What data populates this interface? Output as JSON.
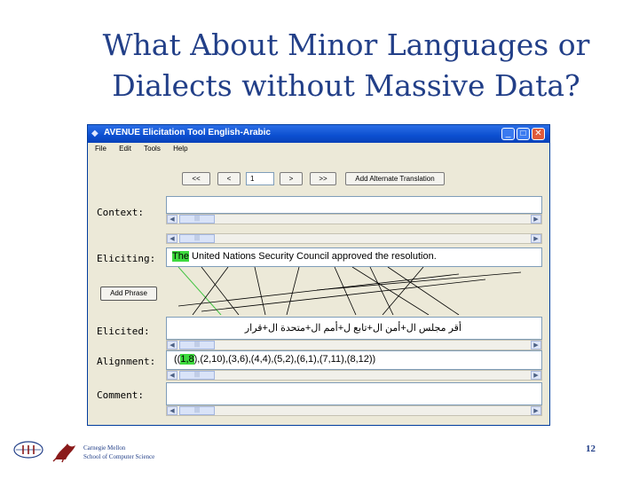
{
  "slide": {
    "title_line1": "What About Minor Languages or",
    "title_line2": "Dialects without Massive Data?",
    "footer_line1": "Carnegie Mellon",
    "footer_line2": "School of Computer Science",
    "page_number": "12"
  },
  "window": {
    "title": "AVENUE Elicitation Tool English-Arabic",
    "menu": [
      "File",
      "Edit",
      "Tools",
      "Help"
    ],
    "controls": [
      "_",
      "□",
      "✕"
    ]
  },
  "toolbar": {
    "first": "<<",
    "prev": "<",
    "index": "1",
    "next": ">",
    "last": ">>",
    "add_alternate": "Add Alternate Translation"
  },
  "labels": {
    "context": "Context:",
    "eliciting": "Eliciting:",
    "elicited": "Elicited:",
    "alignment": "Alignment:",
    "comment": "Comment:"
  },
  "eliciting": {
    "first_word": "The",
    "rest": " United Nations Security Council approved the resolution."
  },
  "add_phrase_label": "Add Phrase",
  "elicited": {
    "text": "أقر مجلس ال+أمن ال+تابع ل+أمم ال+متحدة ال+قرار"
  },
  "alignment": {
    "prefix": "((",
    "highlight": "1,8",
    "rest": "),(2,10),(3,6),(4,4),(5,2),(6,1),(7,11),(8,12))"
  },
  "comment": {
    "text": ""
  },
  "scroll": {
    "left": "◀",
    "right": "▶",
    "grip": "|||"
  },
  "colors": {
    "title_text": "#223f88",
    "highlight": "#3dda3d",
    "titlebar": "#0b4fd0"
  }
}
